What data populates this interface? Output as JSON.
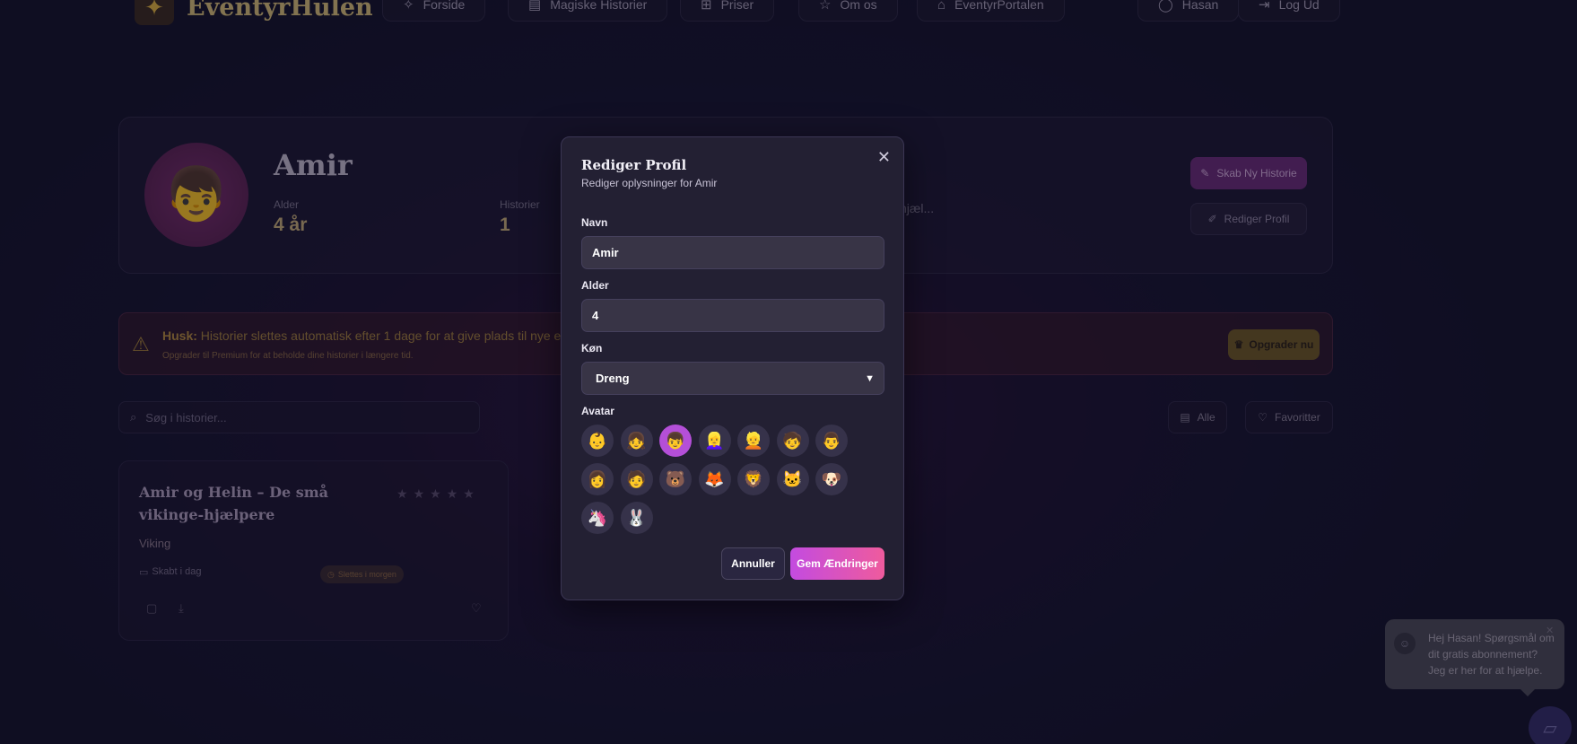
{
  "nav": {
    "logo_text": "EventyrHulen",
    "links": [
      {
        "label": "Forside",
        "icon": "sparkles-icon"
      },
      {
        "label": "Magiske Historier",
        "icon": "book-icon"
      },
      {
        "label": "Priser",
        "icon": "gift-icon"
      },
      {
        "label": "Om os",
        "icon": "star-icon"
      },
      {
        "label": "EventyrPortalen",
        "icon": "home-icon"
      }
    ],
    "user": "Hasan",
    "logout": "Log Ud"
  },
  "profile": {
    "name": "Amir",
    "age_label": "Alder",
    "age_value": "4 år",
    "stories_label": "Historier",
    "stories_value": "1",
    "truncated": "hjæl...",
    "create_button": "Skab Ny Historie",
    "edit_button": "Rediger Profil"
  },
  "warning": {
    "bold": "Husk:",
    "text": "Historier slettes automatisk efter 1 dage for at give plads til nye eventyr! Brug d",
    "sub": "Opgrader til Premium for at beholde dine historier i længere tid.",
    "upgrade_button": "Opgrader nu"
  },
  "search": {
    "placeholder": "Søg i historier..."
  },
  "filters": {
    "all": "Alle",
    "favorites": "Favoritter"
  },
  "story": {
    "title": "Amir og Helin – De små vikinge-hjælpere",
    "genre": "Viking",
    "created": "Skabt i dag",
    "badge": "Slettes i morgen"
  },
  "chat": {
    "message": "Hej Hasan! Spørgsmål om dit gratis abonnement? Jeg er her for at hjælpe."
  },
  "modal": {
    "title": "Rediger Profil",
    "subtitle": "Rediger oplysninger for Amir",
    "name_label": "Navn",
    "name_value": "Amir",
    "age_label": "Alder",
    "age_value": "4",
    "gender_label": "Køn",
    "gender_value": "Dreng",
    "avatar_label": "Avatar",
    "avatars": [
      "👶",
      "👧",
      "👦",
      "👱‍♀️",
      "👱",
      "🧒",
      "👨",
      "👩",
      "🧑",
      "🐻",
      "🦊",
      "🦁",
      "🐱",
      "🐶",
      "🦄",
      "🐰"
    ],
    "selected_avatar_index": 2,
    "cancel": "Annuller",
    "save": "Gem Ændringer"
  },
  "colors": {
    "accent_gradient_start": "#c34be0",
    "accent_gradient_end": "#ef5b9d",
    "selected_avatar": "#b44fd8"
  }
}
